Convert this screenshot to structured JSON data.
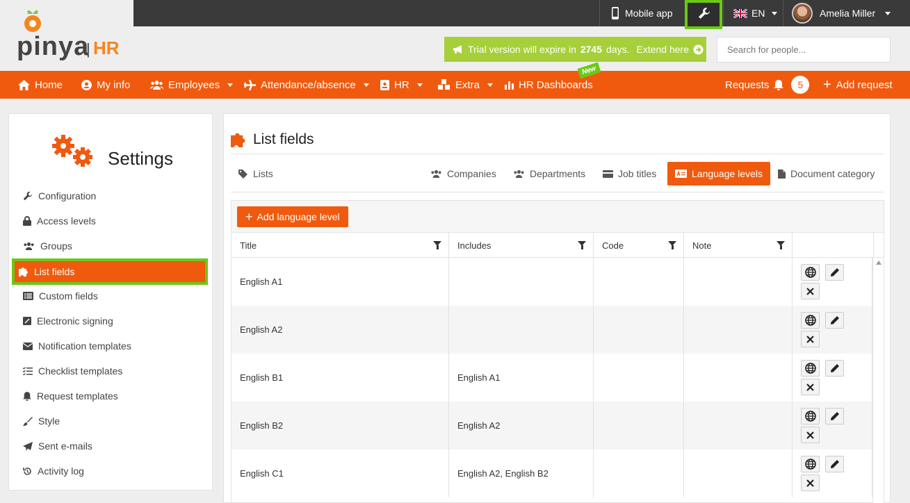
{
  "topbar": {
    "mobile_app": "Mobile app",
    "language": "EN",
    "user_name": "Amelia Miller"
  },
  "logo": {
    "name": "pinya",
    "suffix": "HR"
  },
  "trial": {
    "prefix": "Trial version will expire in",
    "days": "2745",
    "suffix": "days.",
    "extend": "Extend here"
  },
  "search": {
    "placeholder": "Search for people..."
  },
  "nav": {
    "home": "Home",
    "my_info": "My info",
    "employees": "Employees",
    "attendance": "Attendance/absence",
    "hr": "HR",
    "extra": "Extra",
    "hr_dashboards": "HR Dashboards",
    "new_badge": "New",
    "requests": "Requests",
    "requests_count": "5",
    "add_request": "Add request"
  },
  "sidebar": {
    "title": "Settings",
    "items": [
      {
        "label": "Configuration"
      },
      {
        "label": "Access levels"
      },
      {
        "label": "Groups"
      },
      {
        "label": "List fields"
      },
      {
        "label": "Custom fields"
      },
      {
        "label": "Electronic signing"
      },
      {
        "label": "Notification templates"
      },
      {
        "label": "Checklist templates"
      },
      {
        "label": "Request templates"
      },
      {
        "label": "Style"
      },
      {
        "label": "Sent e-mails"
      },
      {
        "label": "Activity log"
      }
    ]
  },
  "main": {
    "title": "List fields",
    "tabs": {
      "lists": "Lists",
      "companies": "Companies",
      "departments": "Departments",
      "job_titles": "Job titles",
      "language_levels": "Language levels",
      "document_category": "Document category"
    },
    "add_button": "Add language level",
    "columns": [
      "Title",
      "Includes",
      "Code",
      "Note"
    ],
    "rows": [
      {
        "title": "English A1",
        "includes": "",
        "code": "",
        "note": ""
      },
      {
        "title": "English A2",
        "includes": "",
        "code": "",
        "note": ""
      },
      {
        "title": "English B1",
        "includes": "English A1",
        "code": "",
        "note": ""
      },
      {
        "title": "English B2",
        "includes": "English A2",
        "code": "",
        "note": ""
      },
      {
        "title": "English C1",
        "includes": "English A2, English B2",
        "code": "",
        "note": ""
      }
    ]
  },
  "colors": {
    "brand_orange": "#f05a0e",
    "highlight_green": "#6cc817",
    "trial_green": "#a7cf3a",
    "topbar_dark": "#3a3a3a"
  }
}
